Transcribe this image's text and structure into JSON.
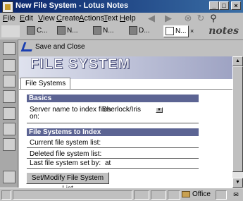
{
  "window": {
    "title": "New File System - Lotus Notes"
  },
  "menubar": {
    "items": [
      {
        "label": "File",
        "u": "F",
        "rest": "ile"
      },
      {
        "label": "Edit",
        "u": "E",
        "rest": "dit"
      },
      {
        "label": "View",
        "u": "V",
        "rest": "iew"
      },
      {
        "label": "Create",
        "u": "C",
        "rest": "reate"
      },
      {
        "label": "Actions",
        "u": "A",
        "rest": "ctions"
      },
      {
        "label": "Text",
        "u": "T",
        "rest": "ext"
      },
      {
        "label": "Help",
        "u": "H",
        "rest": "elp"
      }
    ]
  },
  "tabs": [
    {
      "label": "C..."
    },
    {
      "label": "N..."
    },
    {
      "label": "N..."
    },
    {
      "label": "D..."
    },
    {
      "label": "N..."
    }
  ],
  "brand": "notes",
  "actionbar": {
    "save_close_label": "Save and Close"
  },
  "document": {
    "banner_title": "FILE SYSTEM",
    "tab_label": "File Systems",
    "sections": {
      "basics": "Basics",
      "file_systems_to_index": "File Systems to Index"
    },
    "fields": {
      "server_label": "Server name to index files",
      "server_label_cont": "on:",
      "server_value": "Sherlock/Iris",
      "current_list_label": "Current file system list:",
      "deleted_list_label": "Deleted file system list:",
      "last_set_by_label": "Last file system set by:",
      "last_set_by_value": "at"
    },
    "button_label": "Set/Modify File System List"
  },
  "statusbar": {
    "location": "Office"
  }
}
